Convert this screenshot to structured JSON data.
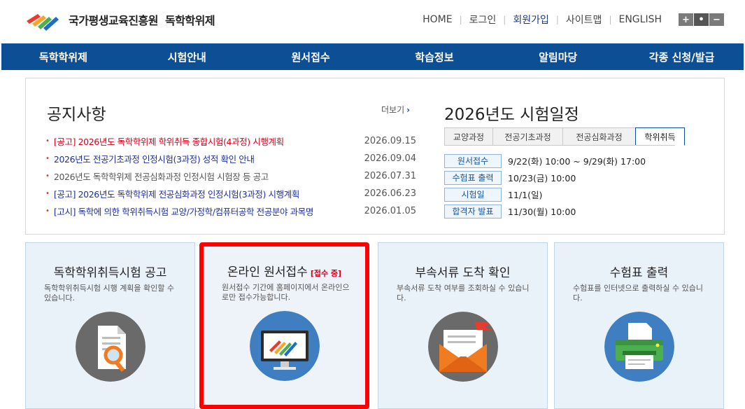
{
  "header": {
    "org_name": "국가평생교육진흥원",
    "system_name": "독학학위제",
    "util_links": [
      "HOME",
      "로그인",
      "회원가입",
      "사이트맵",
      "ENGLISH"
    ],
    "zoom": [
      "+",
      "•",
      "−"
    ]
  },
  "nav": [
    "독학학위제",
    "시험안내",
    "원서접수",
    "학습정보",
    "알림마당",
    "각종 신청/발급"
  ],
  "notice": {
    "title": "공지사항",
    "more": "더보기",
    "items": [
      {
        "text": "[공고] 2026년도 독학학위제 학위취득 종합시험(4과정) 시행계획",
        "date": "2026.09.15",
        "style": "red"
      },
      {
        "text": "2026년도 전공기초과정 인정시험(3과정) 성적 확인 안내",
        "date": "2026.09.04",
        "style": "blue"
      },
      {
        "text": "2026년도 독학학위제 전공심화과정 인정시험 시험장 등 공고",
        "date": "2026.07.31",
        "style": "gray"
      },
      {
        "text": "[공고] 2026년도 독학학위제 전공심화과정 인정시험(3과정) 시행계획",
        "date": "2026.06.23",
        "style": "blue"
      },
      {
        "text": "[고시] 독학에 의한 학위취득시험 교양/가정학/컴퓨터공학 전공분야 과목명",
        "date": "2026.01.05",
        "style": "blue"
      }
    ]
  },
  "schedule": {
    "title": "2026년도 시험일정",
    "tabs": [
      "교양과정",
      "전공기초과정",
      "전공심화과정",
      "학위취득"
    ],
    "active_tab": 3,
    "rows": [
      {
        "label": "원서접수",
        "value": "9/22(화) 10:00 ~ 9/29(화) 17:00"
      },
      {
        "label": "수험표 출력",
        "value": "10/23(금) 10:00"
      },
      {
        "label": "시험일",
        "value": "11/1(일)"
      },
      {
        "label": "합격자 발표",
        "value": "11/30(월) 10:00"
      }
    ]
  },
  "cards": [
    {
      "title": "독학학위취득시험 공고",
      "badge": "",
      "desc": "독학학위취득시험 시행 계획을 확인할 수 있습니다.",
      "icon": "document-search-icon"
    },
    {
      "title": "온라인 원서접수",
      "badge": "[접수 중]",
      "desc": "원서접수 기간에 홈페이지에서 온라인으로만 접수가능합니다.",
      "icon": "monitor-logo-icon"
    },
    {
      "title": "부속서류 도착 확인",
      "badge": "",
      "desc": "부속서류 도착 여부를 조회하실 수 있습니다.",
      "icon": "mail-envelope-icon"
    },
    {
      "title": "수험표 출력",
      "badge": "",
      "desc": "수험표를 인터넷으로 출력하실 수 있습니다.",
      "icon": "printer-icon"
    }
  ],
  "colors": {
    "nav_bg": "#0d4f94",
    "notice_red": "#d6001c",
    "notice_blue": "#1f2f9e",
    "highlight": "#ff0000",
    "card_bg": "#e9f1f9",
    "icon_circle": "#6a6a6a",
    "icon_circle_active": "#3f7fc1"
  }
}
